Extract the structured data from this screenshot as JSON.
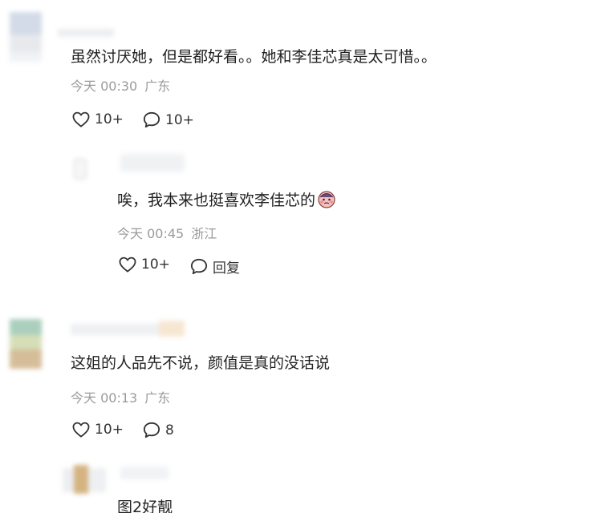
{
  "comments": [
    {
      "text": "虽然讨厌她，但是都好看。。她和李佳芯真是太可惜。。",
      "time": "今天 00:30",
      "location": "广东",
      "likes": "10+",
      "replies": "10+",
      "reply": {
        "text": "唉，我本来也挺喜欢李佳芯的",
        "emoji": "pouting-face-emoji",
        "time": "今天 00:45",
        "location": "浙江",
        "likes": "10+",
        "reply_label": "回复"
      }
    },
    {
      "text": "这姐的人品先不说，颜值是真的没话说",
      "time": "今天 00:13",
      "location": "广东",
      "likes": "10+",
      "replies": "8",
      "reply": {
        "text": "图2好靓"
      }
    }
  ],
  "colors": {
    "text": "#222222",
    "meta": "#9a9a9a",
    "icon": "#333333"
  },
  "icons": {
    "like": "heart-outline-icon",
    "comment": "speech-bubble-outline-icon"
  }
}
